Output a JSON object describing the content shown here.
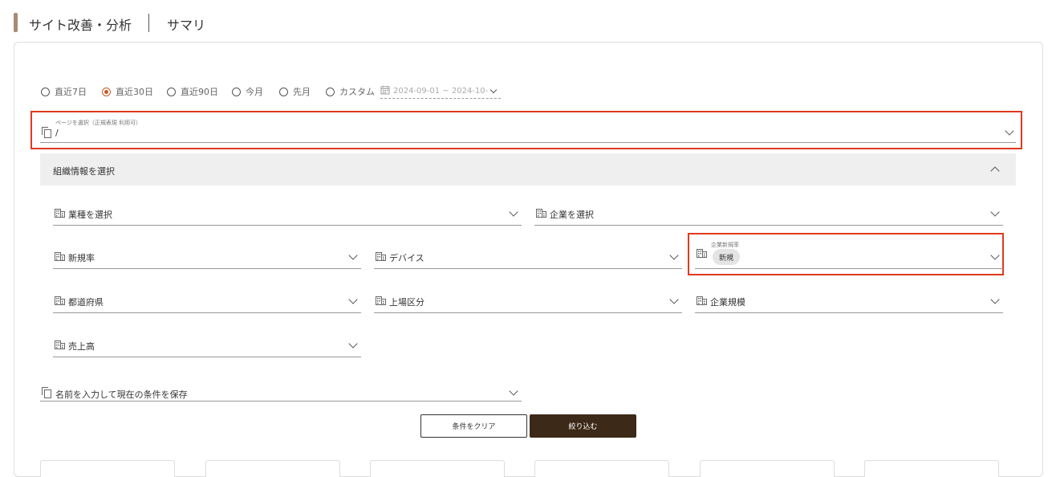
{
  "header": {
    "title": "サイト改善・分析",
    "subtitle": "サマリ"
  },
  "periods": [
    {
      "label": "直近7日",
      "checked": false
    },
    {
      "label": "直近30日",
      "checked": true
    },
    {
      "label": "直近90日",
      "checked": false
    },
    {
      "label": "今月",
      "checked": false
    },
    {
      "label": "先月",
      "checked": false
    },
    {
      "label": "カスタム",
      "checked": false
    }
  ],
  "date_range": "2024-09-01 ~ 2024-10-0",
  "page_select": {
    "label": "ページを選択（正規表現 利用可）",
    "value": "/"
  },
  "org": {
    "header": "組織情報を選択",
    "industry": "業種を選択",
    "company": "企業を選択",
    "new_rate": "新規率",
    "device": "デバイス",
    "company_new_rate_label": "企業新規率",
    "company_new_rate_chip": "新規",
    "prefecture": "都道府県",
    "listing": "上場区分",
    "company_size": "企業規模",
    "revenue": "売上高"
  },
  "save_condition": "名前を入力して現在の条件を保存",
  "buttons": {
    "clear": "条件をクリア",
    "apply": "絞り込む"
  },
  "colors": {
    "accent": "#c45a27",
    "highlight": "#e03a1c",
    "primary_button": "#3d2918",
    "header_bar": "#a68c72"
  }
}
